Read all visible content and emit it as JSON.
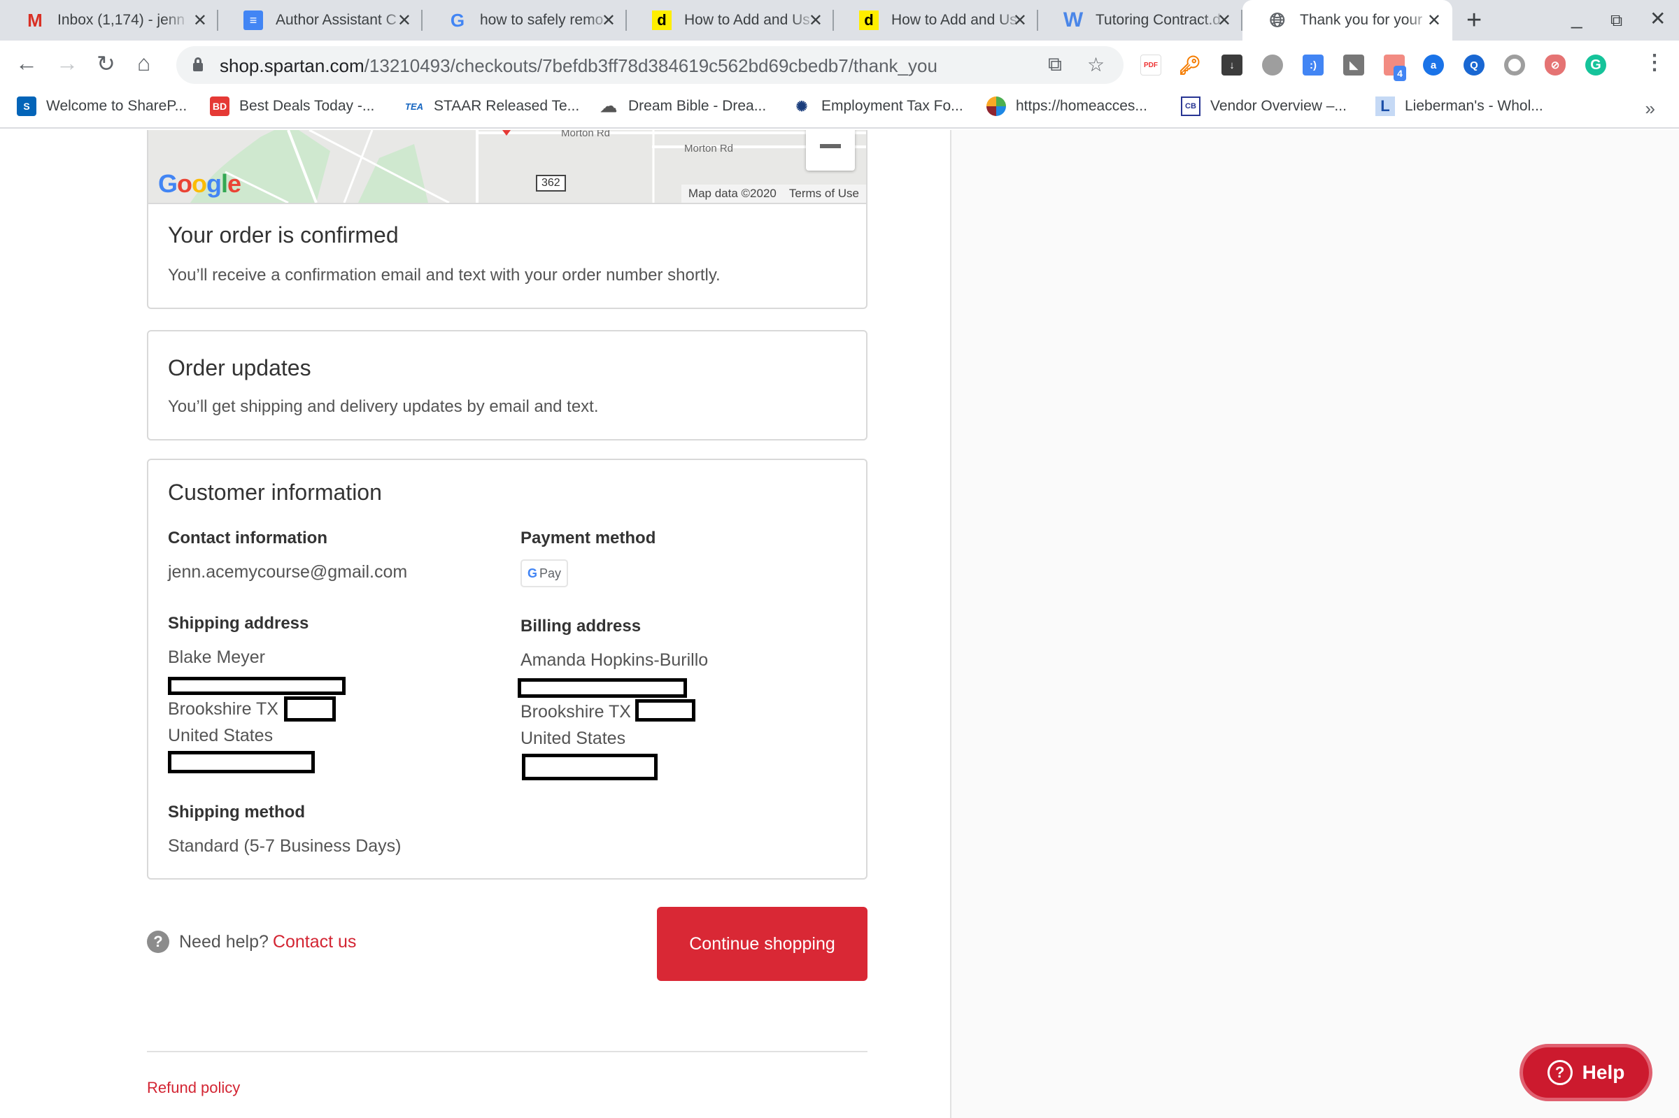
{
  "browser": {
    "tabs": [
      {
        "label": "Inbox (1,174) - jenn",
        "icon": "gmail-icon",
        "active": false
      },
      {
        "label": "Author Assistant C",
        "icon": "google-docs-icon",
        "active": false
      },
      {
        "label": "how to safely remo",
        "icon": "google-icon",
        "active": false
      },
      {
        "label": "How to Add and Us",
        "icon": "dictionary-d-icon",
        "active": false
      },
      {
        "label": "How to Add and Us",
        "icon": "dictionary-d-icon",
        "active": false
      },
      {
        "label": "Tutoring Contract.d",
        "icon": "word-icon",
        "active": false
      },
      {
        "label": "Thank you for your",
        "icon": "globe-icon",
        "active": true
      }
    ],
    "new_tab_symbol": "+",
    "window_controls": {
      "minimize": "_",
      "restore": "⧉",
      "close": "✕"
    },
    "url_host": "shop.spartan.com",
    "url_path": "/13210493/checkouts/7befdb3ff78d384619c562bd69cbedb7/thank_you",
    "extension_badge": "4",
    "bookmarks": [
      {
        "label": "Welcome to ShareP...",
        "icon": "sharepoint-icon"
      },
      {
        "label": "Best Deals Today -...",
        "icon": "best-deals-icon"
      },
      {
        "label": "STAAR Released Te...",
        "icon": "tea-icon"
      },
      {
        "label": "Dream Bible - Drea...",
        "icon": "cloud-icon"
      },
      {
        "label": "Employment Tax Fo...",
        "icon": "irs-icon"
      },
      {
        "label": "https://homeacces...",
        "icon": "homeaccess-icon"
      },
      {
        "label": "Vendor Overview –...",
        "icon": "cb-icon"
      },
      {
        "label": "Lieberman's - Whol...",
        "icon": "lieberman-icon"
      }
    ],
    "bookmarks_overflow": "»"
  },
  "map": {
    "logo": "Google",
    "road_labels": [
      "Morton Rd",
      "Morton Rd"
    ],
    "route_number": "362",
    "attribution": "Map data ©2020",
    "terms": "Terms of Use"
  },
  "confirmation": {
    "title": "Your order is confirmed",
    "message": "You’ll receive a confirmation email and text with your order number shortly."
  },
  "updates": {
    "title": "Order updates",
    "message": "You’ll get shipping and delivery updates by email and text."
  },
  "customer": {
    "title": "Customer information",
    "contact_label": "Contact information",
    "email": "jenn.acemycourse@gmail.com",
    "payment_label": "Payment method",
    "payment_badge": "Pay",
    "shipping_label": "Shipping address",
    "shipping_name": "Blake Meyer",
    "shipping_city": "Brookshire TX",
    "shipping_country": "United States",
    "billing_label": "Billing address",
    "billing_name": "Amanda Hopkins-Burillo",
    "billing_city": "Brookshire TX",
    "billing_country": "United States",
    "method_label": "Shipping method",
    "method": "Standard (5-7 Business Days)"
  },
  "footer": {
    "need_help": "Need help?",
    "contact_link": "Contact us",
    "continue_button": "Continue shopping",
    "refund_policy": "Refund policy"
  },
  "help_widget": {
    "label": "Help"
  },
  "colors": {
    "accent": "#d92835",
    "link": "#d32533",
    "help_widget": "#cc1a2e"
  }
}
